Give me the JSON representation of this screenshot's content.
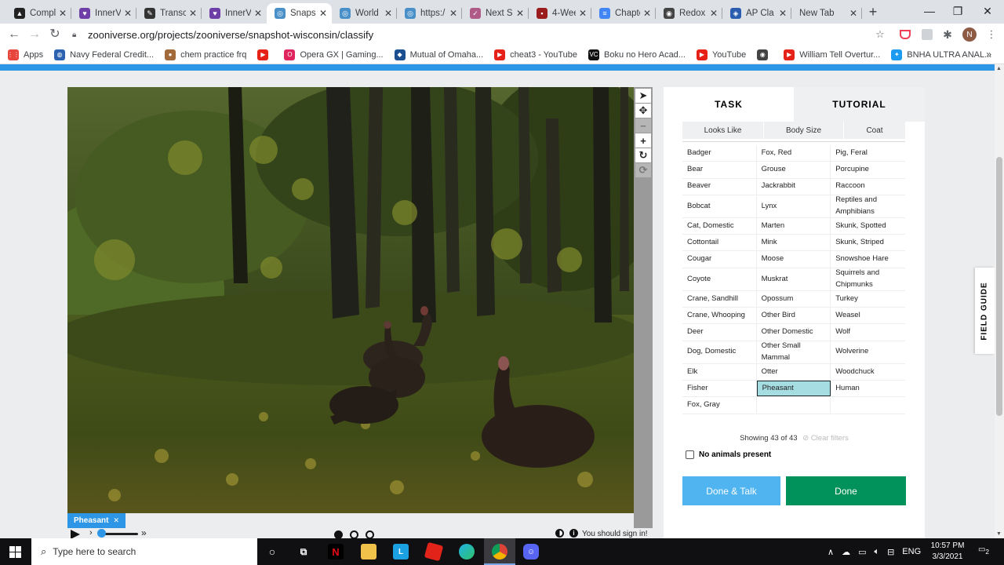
{
  "browser": {
    "tabs": [
      {
        "label": "Compl",
        "color": "#222222",
        "glyph": "▲"
      },
      {
        "label": "InnerV",
        "color": "#6f3fa8",
        "glyph": "♥"
      },
      {
        "label": "Transc",
        "color": "#333333",
        "glyph": "✎"
      },
      {
        "label": "InnerV",
        "color": "#6f3fa8",
        "glyph": "♥"
      },
      {
        "label": "Snapsh",
        "color": "#4a90c8",
        "glyph": "◎"
      },
      {
        "label": "World",
        "color": "#4a90c8",
        "glyph": "◎"
      },
      {
        "label": "https:/",
        "color": "#4a90c8",
        "glyph": "◎"
      },
      {
        "label": "Next S",
        "color": "#b05a88",
        "glyph": "✓"
      },
      {
        "label": "4-Wee",
        "color": "#9b1c1c",
        "glyph": "▪"
      },
      {
        "label": "Chapte",
        "color": "#4285f4",
        "glyph": "≡"
      },
      {
        "label": "Redox",
        "color": "#444444",
        "glyph": "◉"
      },
      {
        "label": "AP Cla",
        "color": "#2a5db0",
        "glyph": "◈"
      },
      {
        "label": "New Tab",
        "color": "",
        "glyph": ""
      }
    ],
    "url": "zooniverse.org/projects/zooniverse/snapshot-wisconsin/classify",
    "profile_initial": "N",
    "bookmarks": [
      {
        "label": "Apps",
        "color": "#e8453c",
        "glyph": "⋮⋮"
      },
      {
        "label": "Navy Federal Credit...",
        "color": "#2d62b0",
        "glyph": "◍"
      },
      {
        "label": "chem practice frq",
        "color": "#a26a3b",
        "glyph": "●"
      },
      {
        "label": "",
        "color": "#e62117",
        "glyph": "▶"
      },
      {
        "label": "Opera GX | Gaming...",
        "color": "#e0245e",
        "glyph": "O"
      },
      {
        "label": "Mutual of Omaha...",
        "color": "#1c4f8f",
        "glyph": "◆"
      },
      {
        "label": "cheat3 - YouTube",
        "color": "#e62117",
        "glyph": "▶"
      },
      {
        "label": "Boku no Hero Acad...",
        "color": "#111111",
        "glyph": "VC"
      },
      {
        "label": "YouTube",
        "color": "#e62117",
        "glyph": "▶"
      },
      {
        "label": "",
        "color": "#444444",
        "glyph": "◉"
      },
      {
        "label": "William Tell Overtur...",
        "color": "#e62117",
        "glyph": "▶"
      },
      {
        "label": "BNHA ULTRA ANAL...",
        "color": "#1d9bf0",
        "glyph": "✦"
      }
    ]
  },
  "classifier": {
    "annotation_chip": "Pheasant",
    "signin_message": "You should sign in!",
    "tabs": {
      "task": "TASK",
      "tutorial": "TUTORIAL"
    },
    "filters": [
      "Looks Like",
      "Body Size",
      "Coat"
    ],
    "choices": [
      [
        "Badger",
        "Fox, Red",
        "Pig, Feral"
      ],
      [
        "Bear",
        "Grouse",
        "Porcupine"
      ],
      [
        "Beaver",
        "Jackrabbit",
        "Raccoon"
      ],
      [
        "Bobcat",
        "Lynx",
        "Reptiles and Amphibians"
      ],
      [
        "Cat, Domestic",
        "Marten",
        "Skunk, Spotted"
      ],
      [
        "Cottontail",
        "Mink",
        "Skunk, Striped"
      ],
      [
        "Cougar",
        "Moose",
        "Snowshoe Hare"
      ],
      [
        "Coyote",
        "Muskrat",
        "Squirrels and Chipmunks"
      ],
      [
        "Crane, Sandhill",
        "Opossum",
        "Turkey"
      ],
      [
        "Crane, Whooping",
        "Other Bird",
        "Weasel"
      ],
      [
        "Deer",
        "Other Domestic",
        "Wolf"
      ],
      [
        "Dog, Domestic",
        "Other Small Mammal",
        "Wolverine"
      ],
      [
        "Elk",
        "Otter",
        "Woodchuck"
      ],
      [
        "Fisher",
        "Pheasant",
        "Human"
      ],
      [
        "Fox, Gray",
        "",
        ""
      ]
    ],
    "selected_choice": "Pheasant",
    "showing": "Showing 43 of 43",
    "clear_filters": "Clear filters",
    "no_animals": "No animals present",
    "done_talk": "Done & Talk",
    "done": "Done",
    "field_guide": "FIELD GUIDE",
    "colors": {
      "accent": "#2d96e6",
      "done": "#00925a",
      "done_talk": "#4fb4ef",
      "selected": "#a6dde3"
    }
  },
  "taskbar": {
    "search_placeholder": "Type here to search",
    "language": "ENG",
    "time": "10:57 PM",
    "date": "3/3/2021",
    "notifications": "2"
  }
}
